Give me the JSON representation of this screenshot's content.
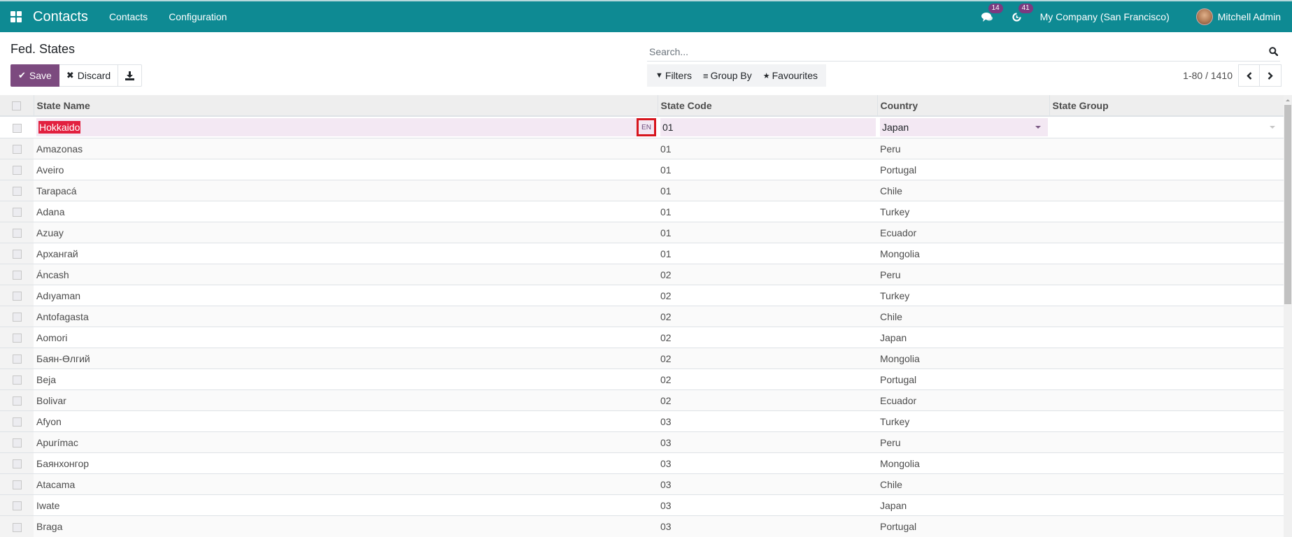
{
  "navbar": {
    "app_name": "Contacts",
    "menu": [
      "Contacts",
      "Configuration"
    ],
    "messages_count": "14",
    "activities_count": "41",
    "company": "My Company (San Francisco)",
    "user": "Mitchell Admin",
    "bg_color": "#0e8a93"
  },
  "control_panel": {
    "title": "Fed. States",
    "save_label": "Save",
    "discard_label": "Discard",
    "search_placeholder": "Search...",
    "filters_label": "Filters",
    "group_by_label": "Group By",
    "favourites_label": "Favourites",
    "pager_value": "1-80 / 1410",
    "primary_color": "#7c4a7f"
  },
  "table": {
    "columns": [
      "State Name",
      "State Code",
      "Country",
      "State Group"
    ],
    "editing_row": {
      "state_name": "Hokkaido",
      "state_code": "01",
      "country": "Japan",
      "state_group": "",
      "lang_label": "EN"
    },
    "rows": [
      {
        "name": "Amazonas",
        "code": "01",
        "country": "Peru",
        "group": ""
      },
      {
        "name": "Aveiro",
        "code": "01",
        "country": "Portugal",
        "group": ""
      },
      {
        "name": "Tarapacá",
        "code": "01",
        "country": "Chile",
        "group": ""
      },
      {
        "name": "Adana",
        "code": "01",
        "country": "Turkey",
        "group": ""
      },
      {
        "name": "Azuay",
        "code": "01",
        "country": "Ecuador",
        "group": ""
      },
      {
        "name": "Архангай",
        "code": "01",
        "country": "Mongolia",
        "group": ""
      },
      {
        "name": "Áncash",
        "code": "02",
        "country": "Peru",
        "group": ""
      },
      {
        "name": "Adıyaman",
        "code": "02",
        "country": "Turkey",
        "group": ""
      },
      {
        "name": "Antofagasta",
        "code": "02",
        "country": "Chile",
        "group": ""
      },
      {
        "name": "Aomori",
        "code": "02",
        "country": "Japan",
        "group": ""
      },
      {
        "name": "Баян-Өлгий",
        "code": "02",
        "country": "Mongolia",
        "group": ""
      },
      {
        "name": "Beja",
        "code": "02",
        "country": "Portugal",
        "group": ""
      },
      {
        "name": "Bolivar",
        "code": "02",
        "country": "Ecuador",
        "group": ""
      },
      {
        "name": "Afyon",
        "code": "03",
        "country": "Turkey",
        "group": ""
      },
      {
        "name": "Apurímac",
        "code": "03",
        "country": "Peru",
        "group": ""
      },
      {
        "name": "Баянхонгор",
        "code": "03",
        "country": "Mongolia",
        "group": ""
      },
      {
        "name": "Atacama",
        "code": "03",
        "country": "Chile",
        "group": ""
      },
      {
        "name": "Iwate",
        "code": "03",
        "country": "Japan",
        "group": ""
      },
      {
        "name": "Braga",
        "code": "03",
        "country": "Portugal",
        "group": ""
      }
    ]
  }
}
